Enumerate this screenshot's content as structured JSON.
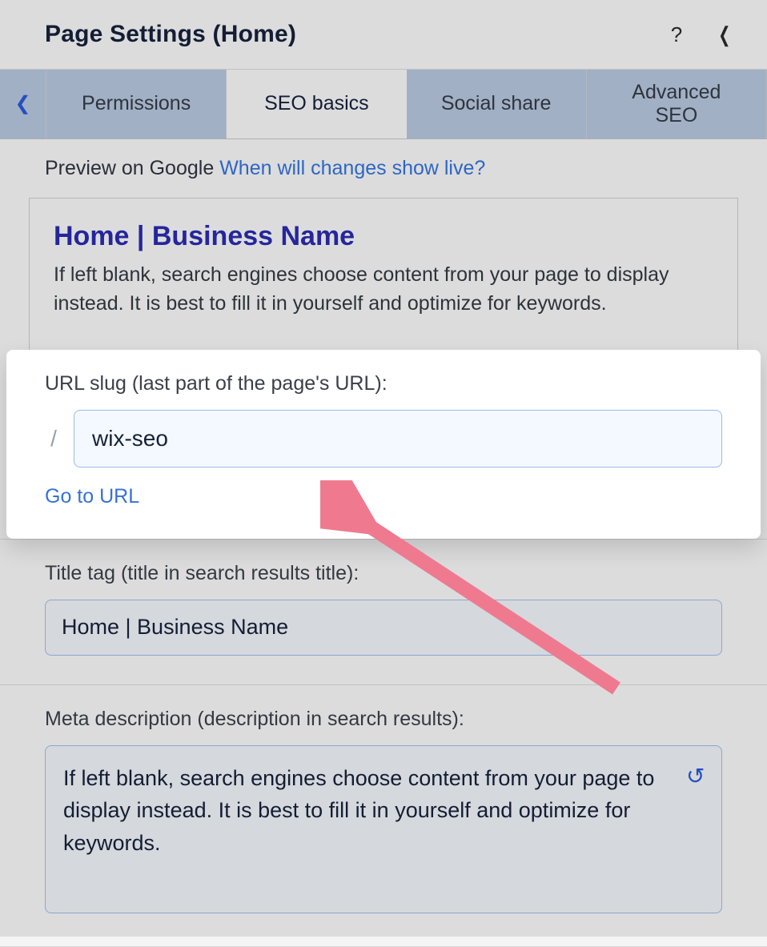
{
  "header": {
    "title": "Page Settings (Home)"
  },
  "tabs": {
    "items": [
      {
        "label": "Permissions"
      },
      {
        "label": "SEO basics"
      },
      {
        "label": "Social share"
      },
      {
        "label": "Advanced SEO"
      }
    ],
    "active_index": 1
  },
  "preview": {
    "label": "Preview on Google",
    "link_text": "When will changes show live?",
    "google_title": "Home | Business Name",
    "google_desc": "If left blank, search engines choose content from your page to display instead. It is best to fill it in yourself and optimize for keywords."
  },
  "url_slug": {
    "label": "URL slug (last part of the page's URL):",
    "prefix": "/",
    "value": "wix-seo",
    "go_link": "Go to URL"
  },
  "title_tag": {
    "label": "Title tag (title in search results title):",
    "value": "Home | Business Name"
  },
  "meta_description": {
    "label": "Meta description (description in search results):",
    "value": "If left blank, search engines choose content from your page to display instead. It is best to fill it in yourself and optimize for keywords."
  },
  "colors": {
    "link": "#3472d8",
    "google_title": "#2a2bad",
    "arrow": "#ef7a8f"
  }
}
